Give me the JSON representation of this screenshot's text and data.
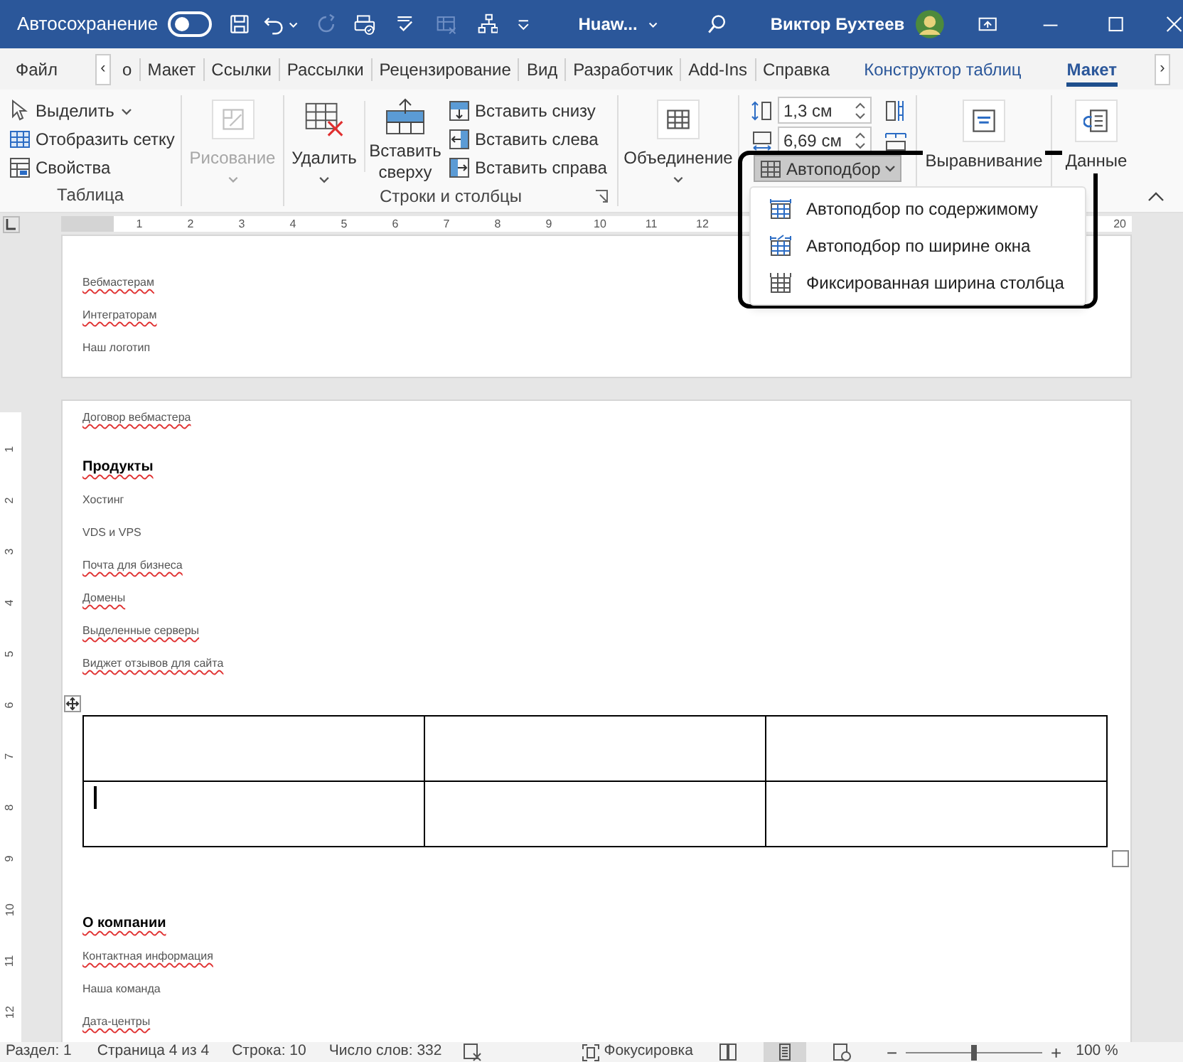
{
  "title_bar": {
    "autosave_label": "Автосохранение",
    "autosave_on": false,
    "file_name": "Huaw...",
    "user_name": "Виктор Бухтеев"
  },
  "tabs": [
    {
      "label": "Файл",
      "kind": "plain",
      "selected": false
    },
    {
      "label": "‹",
      "kind": "scroll"
    },
    {
      "label": "о",
      "kind": "plain",
      "selected": false
    },
    {
      "label": "Макет",
      "kind": "plain",
      "selected": false
    },
    {
      "label": "Ссылки",
      "kind": "plain",
      "selected": false
    },
    {
      "label": "Рассылки",
      "kind": "plain",
      "selected": false
    },
    {
      "label": "Рецензирование",
      "kind": "plain",
      "selected": false
    },
    {
      "label": "Вид",
      "kind": "plain",
      "selected": false
    },
    {
      "label": "Разработчик",
      "kind": "plain",
      "selected": false
    },
    {
      "label": "Add-Ins",
      "kind": "plain",
      "selected": false
    },
    {
      "label": "Справка",
      "kind": "plain",
      "selected": false
    },
    {
      "label": "Конструктор таблиц",
      "kind": "contextual",
      "selected": false
    },
    {
      "label": "Макет",
      "kind": "contextual",
      "selected": true
    },
    {
      "label": "›",
      "kind": "scroll"
    }
  ],
  "ribbon": {
    "table_group": {
      "label": "Таблица",
      "select": "Выделить",
      "gridlines": "Отобразить сетку",
      "properties": "Свойства"
    },
    "draw_group": {
      "label": "Рисование",
      "disabled": true
    },
    "rows_cols_group": {
      "label": "Строки и столбцы",
      "delete": "Удалить",
      "insert_above": "Вставить сверху",
      "insert_below": "Вставить снизу",
      "insert_left": "Вставить слева",
      "insert_right": "Вставить справа"
    },
    "merge": "Объединение",
    "cell_size": {
      "height": "1,3 см",
      "width": "6,69 см"
    },
    "alignment": "Выравнивание",
    "data": "Данные"
  },
  "autofit": {
    "label": "Автоподбор",
    "expanded": true,
    "items": [
      {
        "label": "Автоподбор по содержимому"
      },
      {
        "label": "Автоподбор по ширине окна"
      },
      {
        "label": "Фиксированная ширина столбца"
      }
    ]
  },
  "ruler": {
    "h_numbers": [
      "1",
      "2",
      "3",
      "4",
      "5",
      "6",
      "7",
      "8",
      "9",
      "10",
      "11",
      "12"
    ],
    "h_end": "20",
    "v_numbers": [
      "1",
      "2",
      "3",
      "4",
      "5",
      "6",
      "7",
      "8",
      "9",
      "10",
      "11",
      "12"
    ]
  },
  "page_1": {
    "lines": [
      {
        "text": "Вебмастерам",
        "misspelled": true
      },
      {
        "text": "Интеграторам",
        "misspelled": true
      },
      {
        "text": "Наш логотип",
        "misspelled": false
      }
    ]
  },
  "page_2": {
    "blocks": [
      {
        "kind": "text",
        "text": "Договор вебмастера",
        "misspelled": true
      },
      {
        "kind": "heading",
        "text": "Продукты",
        "misspelled": true
      },
      {
        "kind": "text",
        "text": "Хостинг",
        "misspelled": false
      },
      {
        "kind": "text",
        "text": "VDS и VPS",
        "misspelled": false
      },
      {
        "kind": "text",
        "text": "Почта для бизнеса",
        "misspelled": true
      },
      {
        "kind": "text",
        "text": "Домены",
        "misspelled": true
      },
      {
        "kind": "text",
        "text": "Выделенные серверы",
        "misspelled": true
      },
      {
        "kind": "text",
        "text": "Виджет отзывов для сайта",
        "misspelled": true
      },
      {
        "kind": "table",
        "rows": [
          [
            {
              "cursor": false
            },
            {
              "cursor": false
            },
            {
              "cursor": false
            }
          ],
          [
            {
              "cursor": true
            },
            {
              "cursor": false
            },
            {
              "cursor": false
            }
          ]
        ]
      },
      {
        "kind": "heading",
        "text": "О компании",
        "misspelled": true
      },
      {
        "kind": "text",
        "text": "Контактная информация",
        "misspelled": true
      },
      {
        "kind": "text",
        "text": "Наша команда",
        "misspelled": false
      },
      {
        "kind": "text",
        "text": "Дата-центры",
        "misspelled": true
      }
    ]
  },
  "status_bar": {
    "section": "Раздел: 1",
    "page": "Страница 4 из 4",
    "line": "Строка: 10",
    "words": "Число слов: 332",
    "focus": "Фокусировка",
    "views": [
      {
        "kind": "read",
        "selected": false
      },
      {
        "kind": "print",
        "selected": true
      },
      {
        "kind": "web",
        "selected": false
      }
    ],
    "zoom_out": "−",
    "zoom_in": "+",
    "zoom_slider": {
      "level": 0.5
    },
    "zoom": "100 %"
  }
}
